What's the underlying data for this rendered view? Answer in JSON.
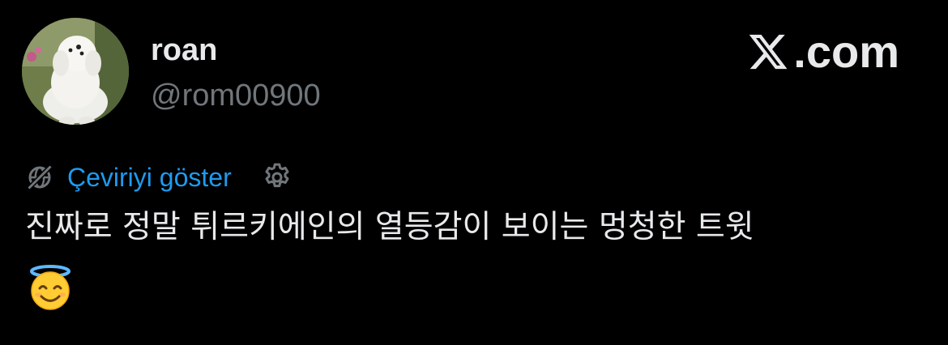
{
  "user": {
    "display_name": "roan",
    "handle": "@rom00900",
    "avatar": "white-fluffy-dog-photo"
  },
  "brand": {
    "label": ".com",
    "icon": "x-logo-icon"
  },
  "translate": {
    "label": "Çeviriyi göster",
    "icon": "globe-slash-icon",
    "settings_icon": "gear-icon"
  },
  "tweet": {
    "text": "진짜로 정말 튀르키에인의 열등감이 보이는 멍청한 트윗",
    "emoji": "smiling-face-with-halo-emoji"
  },
  "colors": {
    "background": "#000000",
    "text_primary": "#e7e9ea",
    "text_secondary": "#71767b",
    "link": "#1d9bf0"
  }
}
